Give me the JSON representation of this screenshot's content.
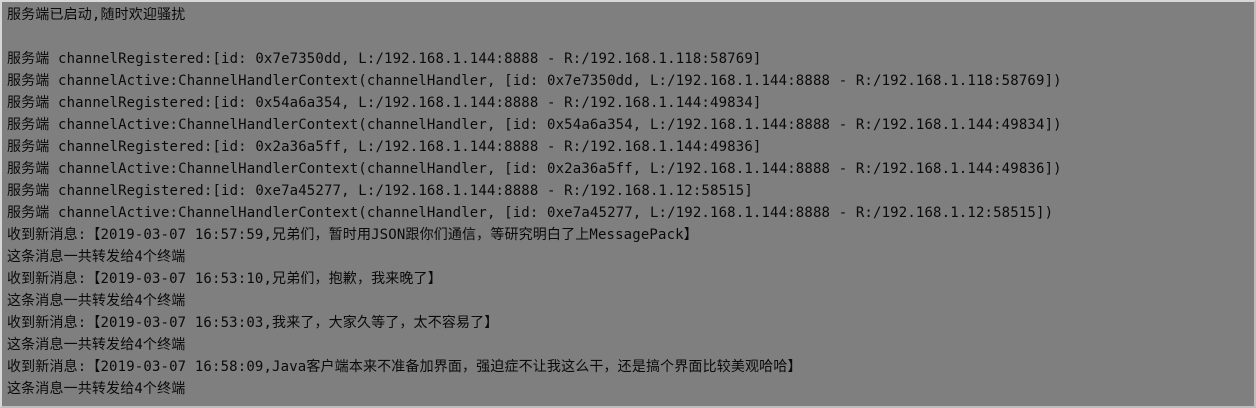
{
  "console": {
    "lines": [
      "服务端已启动,随时欢迎骚扰",
      "",
      "服务端 channelRegistered:[id: 0x7e7350dd, L:/192.168.1.144:8888 - R:/192.168.1.118:58769]",
      "服务端 channelActive:ChannelHandlerContext(channelHandler, [id: 0x7e7350dd, L:/192.168.1.144:8888 - R:/192.168.1.118:58769])",
      "服务端 channelRegistered:[id: 0x54a6a354, L:/192.168.1.144:8888 - R:/192.168.1.144:49834]",
      "服务端 channelActive:ChannelHandlerContext(channelHandler, [id: 0x54a6a354, L:/192.168.1.144:8888 - R:/192.168.1.144:49834])",
      "服务端 channelRegistered:[id: 0x2a36a5ff, L:/192.168.1.144:8888 - R:/192.168.1.144:49836]",
      "服务端 channelActive:ChannelHandlerContext(channelHandler, [id: 0x2a36a5ff, L:/192.168.1.144:8888 - R:/192.168.1.144:49836])",
      "服务端 channelRegistered:[id: 0xe7a45277, L:/192.168.1.144:8888 - R:/192.168.1.12:58515]",
      "服务端 channelActive:ChannelHandlerContext(channelHandler, [id: 0xe7a45277, L:/192.168.1.144:8888 - R:/192.168.1.12:58515])",
      "收到新消息:【2019-03-07 16:57:59,兄弟们，暂时用JSON跟你们通信，等研究明白了上MessagePack】",
      "这条消息一共转发给4个终端",
      "收到新消息:【2019-03-07 16:53:10,兄弟们，抱歉，我来晚了】",
      "这条消息一共转发给4个终端",
      "收到新消息:【2019-03-07 16:53:03,我来了，大家久等了，太不容易了】",
      "这条消息一共转发给4个终端",
      "收到新消息:【2019-03-07 16:58:09,Java客户端本来不准备加界面，强迫症不让我这么干，还是搞个界面比较美观哈哈】",
      "这条消息一共转发给4个终端"
    ]
  }
}
